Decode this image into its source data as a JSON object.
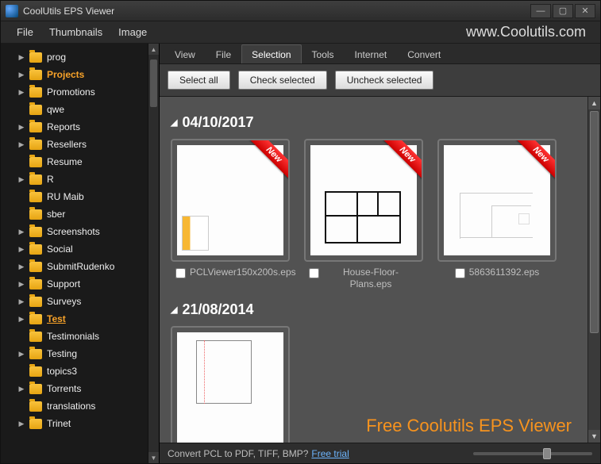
{
  "window": {
    "title": "CoolUtils EPS Viewer"
  },
  "menubar": {
    "items": [
      "File",
      "Thumbnails",
      "Image"
    ],
    "brand": "www.Coolutils.com"
  },
  "sidebar": {
    "items": [
      {
        "label": "prog",
        "expandable": true
      },
      {
        "label": "Projects",
        "expandable": true,
        "highlight": "hl"
      },
      {
        "label": "Promotions",
        "expandable": true
      },
      {
        "label": "qwe",
        "expandable": false
      },
      {
        "label": "Reports",
        "expandable": true
      },
      {
        "label": "Resellers",
        "expandable": true
      },
      {
        "label": "Resume",
        "expandable": false
      },
      {
        "label": "R",
        "expandable": true
      },
      {
        "label": "RU Maib",
        "expandable": false
      },
      {
        "label": "sber",
        "expandable": false
      },
      {
        "label": "Screenshots",
        "expandable": true
      },
      {
        "label": "Social",
        "expandable": true
      },
      {
        "label": "SubmitRudenko",
        "expandable": true
      },
      {
        "label": "Support",
        "expandable": true
      },
      {
        "label": "Surveys",
        "expandable": true
      },
      {
        "label": "Test",
        "expandable": true,
        "highlight": "hl2"
      },
      {
        "label": "Testimonials",
        "expandable": false
      },
      {
        "label": "Testing",
        "expandable": true
      },
      {
        "label": "topics3",
        "expandable": false
      },
      {
        "label": "Torrents",
        "expandable": true
      },
      {
        "label": "translations",
        "expandable": false
      },
      {
        "label": "Trinet",
        "expandable": true
      }
    ]
  },
  "tabs": {
    "items": [
      "View",
      "File",
      "Selection",
      "Tools",
      "Internet",
      "Convert"
    ],
    "active": 2
  },
  "toolbar": {
    "select_all": "Select all",
    "check_selected": "Check selected",
    "uncheck_selected": "Uncheck selected"
  },
  "gallery": {
    "groups": [
      {
        "date": "04/10/2017",
        "items": [
          {
            "caption": "PCLViewer150x200s.eps",
            "ribbon": "New",
            "thumb": "pcl"
          },
          {
            "caption": "House-Floor-Plans.eps",
            "ribbon": "New",
            "thumb": "plan"
          },
          {
            "caption": "5863611392.eps",
            "ribbon": "New",
            "thumb": "faint"
          }
        ]
      },
      {
        "date": "21/08/2014",
        "items": [
          {
            "caption": "",
            "thumb": "partial"
          }
        ]
      }
    ],
    "overlay_title": "Free Coolutils EPS Viewer"
  },
  "status": {
    "text": "Convert PCL to PDF, TIFF, BMP?",
    "link": "Free trial"
  }
}
